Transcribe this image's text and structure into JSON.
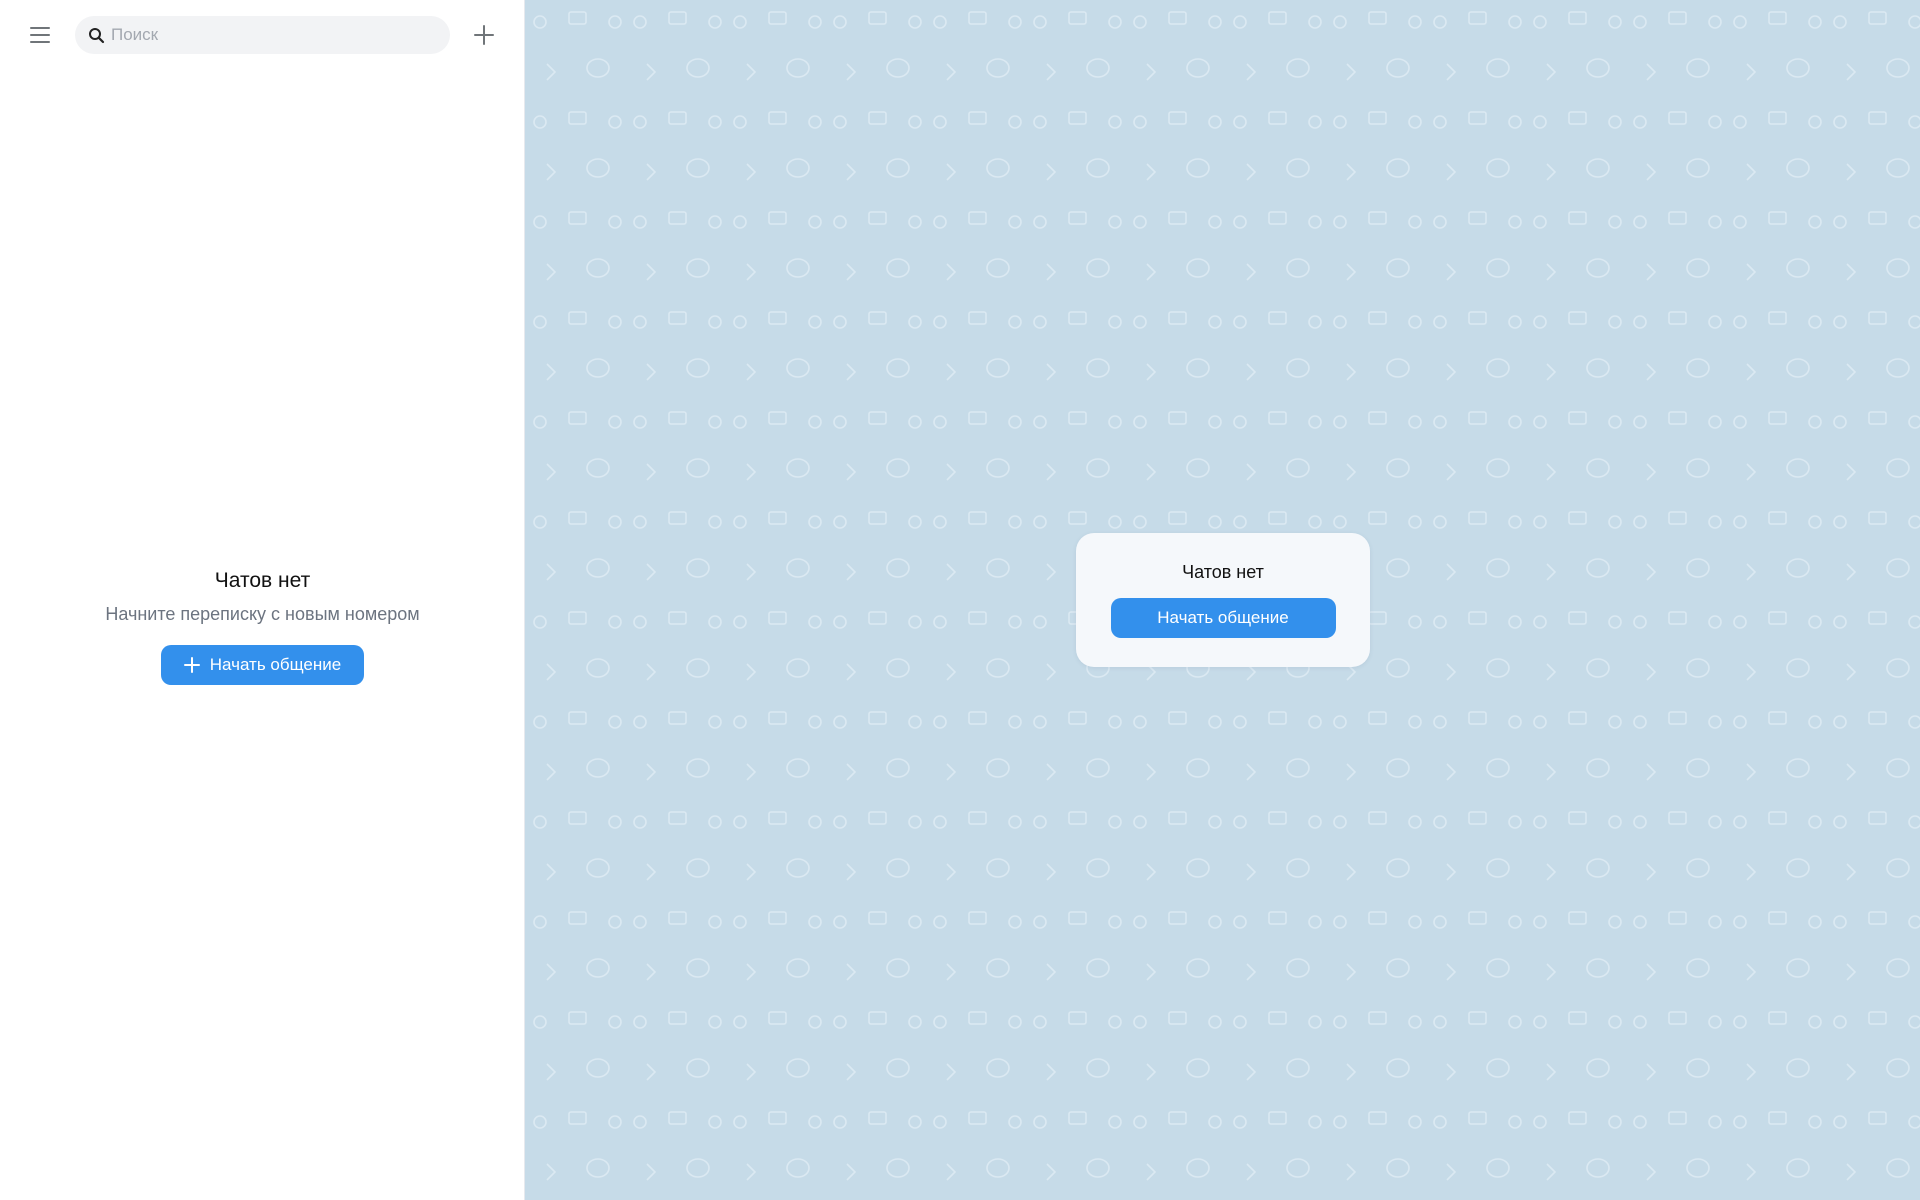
{
  "sidebar": {
    "menu_icon": "hamburger-menu-icon",
    "search": {
      "placeholder": "Поиск",
      "value": "",
      "icon": "search-icon"
    },
    "add_icon": "plus-icon",
    "empty_state": {
      "title": "Чатов нет",
      "subtitle": "Начните переписку с новым номером",
      "button_label": "Начать общение",
      "button_icon": "plus-icon"
    }
  },
  "main": {
    "card": {
      "title": "Чатов нет",
      "button_label": "Начать общение"
    }
  },
  "colors": {
    "accent": "#3390ec",
    "background": "#c6dbe8",
    "card": "#f5f8fb",
    "sidebar": "#ffffff"
  }
}
